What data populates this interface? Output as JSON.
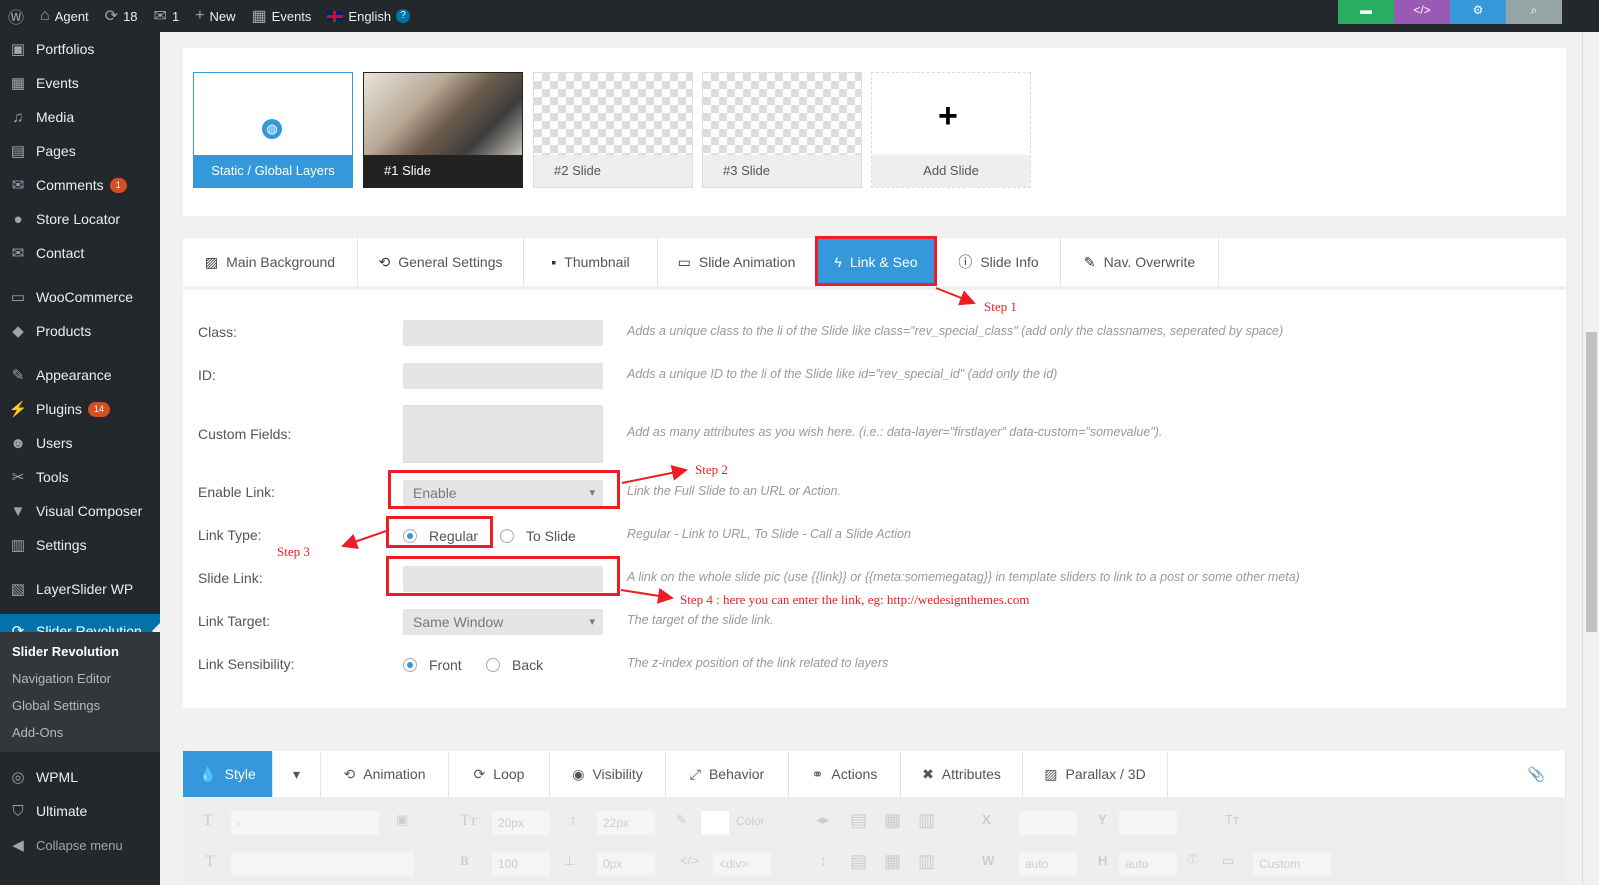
{
  "adminbar": {
    "site_name": "Agent",
    "updates_count": "18",
    "comments_count": "1",
    "new_label": "New",
    "events_label": "Events",
    "language_label": "English",
    "wp_icon": "wordpress-icon",
    "help_icon": "question-icon",
    "colors": [
      "#27ae60",
      "#9b59b6",
      "#3498db",
      "#95a5a6"
    ]
  },
  "sidebar": {
    "items": [
      {
        "label": "Portfolios",
        "icon": "portfolio-icon"
      },
      {
        "label": "Events",
        "icon": "calendar-icon"
      },
      {
        "label": "Media",
        "icon": "media-icon"
      },
      {
        "label": "Pages",
        "icon": "pages-icon"
      },
      {
        "label": "Comments",
        "icon": "comment-icon",
        "badge": "1"
      },
      {
        "label": "Store Locator",
        "icon": "pin-icon"
      },
      {
        "label": "Contact",
        "icon": "mail-icon"
      },
      {
        "label": "WooCommerce",
        "icon": "woo-icon"
      },
      {
        "label": "Products",
        "icon": "box-icon"
      },
      {
        "label": "Appearance",
        "icon": "brush-icon"
      },
      {
        "label": "Plugins",
        "icon": "plug-icon",
        "badge": "14"
      },
      {
        "label": "Users",
        "icon": "user-icon"
      },
      {
        "label": "Tools",
        "icon": "wrench-icon"
      },
      {
        "label": "Visual Composer",
        "icon": "vc-icon"
      },
      {
        "label": "Settings",
        "icon": "settings-icon"
      },
      {
        "label": "LayerSlider WP",
        "icon": "layers-icon"
      },
      {
        "label": "Slider Revolution",
        "icon": "refresh-icon"
      },
      {
        "label": "WPML",
        "icon": "wpml-icon"
      },
      {
        "label": "Ultimate",
        "icon": "shield-icon"
      },
      {
        "label": "Collapse menu",
        "icon": "collapse-icon"
      }
    ],
    "submenu": [
      "Slider Revolution",
      "Navigation Editor",
      "Global Settings",
      "Add-Ons"
    ]
  },
  "slides": {
    "static_label": "Static / Global Layers",
    "slide1": "#1 Slide",
    "slide2": "#2 Slide",
    "slide3": "#3 Slide",
    "add_label": "Add Slide"
  },
  "tabs": [
    {
      "label": "Main Background",
      "icon": "image-icon"
    },
    {
      "label": "General Settings",
      "icon": "history-icon"
    },
    {
      "label": "Thumbnail",
      "icon": "thumbnail-icon"
    },
    {
      "label": "Slide Animation",
      "icon": "animation-icon"
    },
    {
      "label": "Link & Seo",
      "icon": "bolt-icon"
    },
    {
      "label": "Slide Info",
      "icon": "info-icon"
    },
    {
      "label": "Nav. Overwrite",
      "icon": "wand-icon"
    }
  ],
  "form": {
    "class_label": "Class:",
    "class_help": "Adds a unique class to the li of the Slide like class=\"rev_special_class\" (add only the classnames, seperated by space)",
    "id_label": "ID:",
    "id_help": "Adds a unique ID to the li of the Slide like id=\"rev_special_id\" (add only the id)",
    "custom_label": "Custom Fields:",
    "custom_help": "Add as many attributes as you wish here. (i.e.: data-layer=\"firstlayer\" data-custom=\"somevalue\").",
    "enable_label": "Enable Link:",
    "enable_value": "Enable",
    "enable_help": "Link the Full Slide to an URL or Action.",
    "linktype_label": "Link Type:",
    "linktype_regular": "Regular",
    "linktype_toslide": "To Slide",
    "linktype_help": "Regular - Link to URL, To Slide - Call a Slide Action",
    "slidelink_label": "Slide Link:",
    "slidelink_help": "A link on the whole slide pic (use {{link}} or {{meta:somemegatag}} in template sliders to link to a post or some other meta)",
    "target_label": "Link Target:",
    "target_value": "Same Window",
    "target_help": "The target of the slide link.",
    "sens_label": "Link Sensibility:",
    "sens_front": "Front",
    "sens_back": "Back",
    "sens_help": "The z-index position of the link related to layers"
  },
  "annotations": {
    "step1": "Step 1",
    "step2": "Step 2",
    "step3": "Step 3",
    "step4": "Step 4 : here you can enter the link, eg: http://wedesignthemes.com"
  },
  "layer_tabs": [
    {
      "label": "Style",
      "icon": "drop-icon"
    },
    {
      "label": "Animation",
      "icon": "history-icon"
    },
    {
      "label": "Loop",
      "icon": "loop-icon"
    },
    {
      "label": "Visibility",
      "icon": "eye-icon"
    },
    {
      "label": "Behavior",
      "icon": "expand-icon"
    },
    {
      "label": "Actions",
      "icon": "link-icon"
    },
    {
      "label": "Attributes",
      "icon": "tools-icon"
    },
    {
      "label": "Parallax / 3D",
      "icon": "image-icon"
    }
  ],
  "toolbar": {
    "font_size": "20px",
    "line_height": "22px",
    "color_label": "Color",
    "weight": "100",
    "spacing": "0px",
    "tag": "<div>",
    "x_label": "X",
    "y_label": "Y",
    "w_label": "W",
    "h_label": "H",
    "w_value": "auto",
    "h_value": "auto",
    "custom_label": "Custom",
    "dash": "-"
  }
}
